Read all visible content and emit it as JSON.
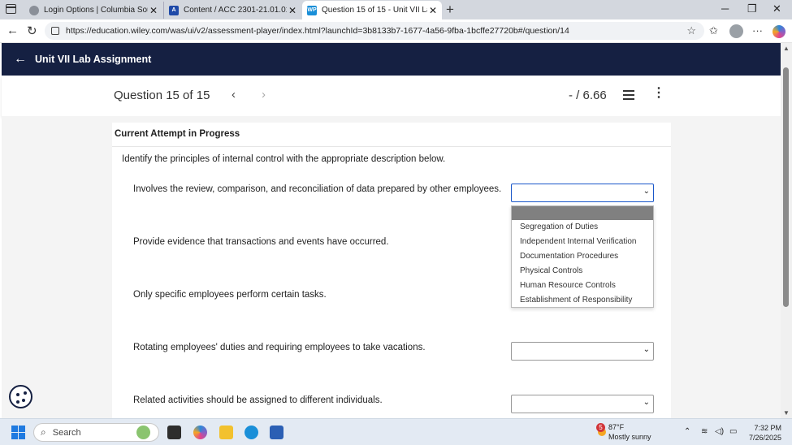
{
  "browser": {
    "tabs": [
      {
        "title": "Login Options | Columbia Southe",
        "active": false
      },
      {
        "title": "Content / ACC 2301-21.01.01-182",
        "active": false
      },
      {
        "title": "Question 15 of 15 - Unit VII Lab A",
        "active": true
      }
    ],
    "url": "https://education.wiley.com/was/ui/v2/assessment-player/index.html?launchId=3b8133b7-1677-4a56-9fba-1bcffe27720b#/question/14"
  },
  "app": {
    "title": "Unit VII Lab Assignment"
  },
  "question": {
    "label": "Question 15 of 15",
    "score": "- / 6.66",
    "attempt_status": "Current Attempt in Progress",
    "instruction": "Identify the principles of internal control with the appropriate description below.",
    "items": [
      {
        "description": "Involves the review, comparison, and reconciliation of data prepared by other employees.",
        "selected": ""
      },
      {
        "description": "Provide evidence that transactions and events have occurred.",
        "selected": ""
      },
      {
        "description": "Only specific employees perform certain tasks.",
        "selected": ""
      },
      {
        "description": "Rotating employees' duties and requiring employees to take vacations.",
        "selected": ""
      },
      {
        "description": "Related activities should be assigned to different individuals.",
        "selected": ""
      }
    ],
    "dropdown_options": [
      "Segregation of Duties",
      "Independent Internal Verification",
      "Documentation Procedures",
      "Physical Controls",
      "Human Resource Controls",
      "Establishment of Responsibility"
    ]
  },
  "taskbar": {
    "search_placeholder": "Search",
    "weather_badge": "5",
    "temperature": "87°F",
    "condition": "Mostly sunny",
    "time": "7:32 PM",
    "date": "7/26/2025"
  },
  "colors": {
    "header_bg": "#152042",
    "focus_border": "#1a57c9",
    "highlight_option": "#808080"
  }
}
